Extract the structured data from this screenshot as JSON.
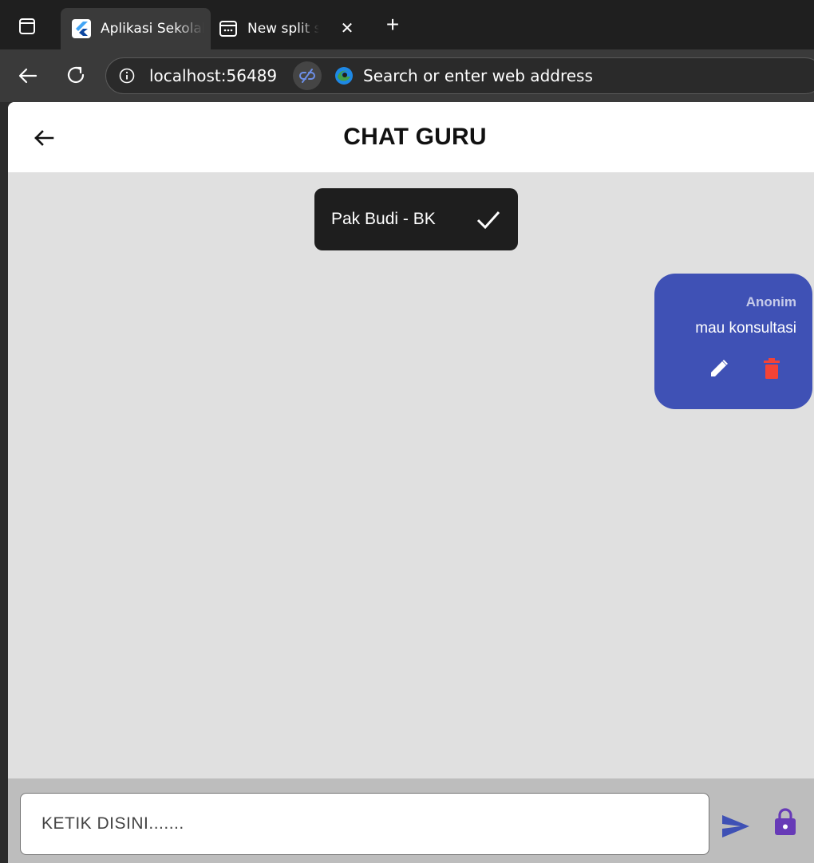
{
  "browser": {
    "tabs": [
      {
        "label": "Aplikasi Sekolah",
        "active": true
      },
      {
        "label": "New split screen",
        "active": false
      }
    ],
    "close_glyph": "✕",
    "new_tab_glyph": "+",
    "host": "localhost:56489",
    "search_placeholder": "Search or enter web address"
  },
  "app": {
    "title": "CHAT GURU",
    "teacher_chip": {
      "name": "Pak Budi - BK",
      "icon": "check-icon"
    },
    "messages": [
      {
        "sender": "Anonim",
        "text": "mau konsultasi",
        "actions": [
          "edit-icon",
          "delete-icon"
        ]
      }
    ],
    "composer": {
      "placeholder": "KETIK DISINI.......",
      "value": ""
    }
  },
  "colors": {
    "app_background": "#e0e0e0",
    "bubble": "#3f51b5",
    "sender": "#c5cae9",
    "delete": "#f44336",
    "send": "#3f51b5",
    "lock": "#673ab7",
    "chip": "#1e1e1e"
  }
}
